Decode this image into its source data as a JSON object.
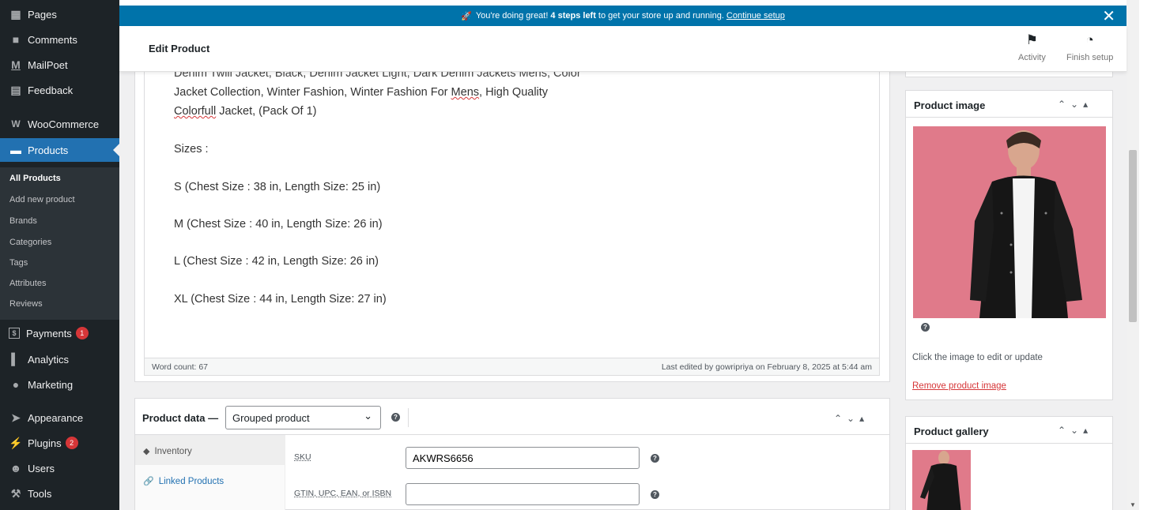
{
  "sidebar": {
    "items": [
      {
        "label": "Pages",
        "icon": "pages-icon"
      },
      {
        "label": "Comments",
        "icon": "comments-icon"
      },
      {
        "label": "MailPoet",
        "icon": "mailpoet-icon"
      },
      {
        "label": "Feedback",
        "icon": "feedback-icon"
      },
      {
        "label": "WooCommerce",
        "icon": "woocommerce-icon"
      },
      {
        "label": "Products",
        "icon": "products-icon"
      },
      {
        "label": "Payments",
        "icon": "payments-icon",
        "badge": "1"
      },
      {
        "label": "Analytics",
        "icon": "analytics-icon"
      },
      {
        "label": "Marketing",
        "icon": "marketing-icon"
      },
      {
        "label": "Appearance",
        "icon": "appearance-icon"
      },
      {
        "label": "Plugins",
        "icon": "plugins-icon",
        "badge": "2"
      },
      {
        "label": "Users",
        "icon": "users-icon"
      },
      {
        "label": "Tools",
        "icon": "tools-icon"
      }
    ],
    "submenu": [
      "All Products",
      "Add new product",
      "Brands",
      "Categories",
      "Tags",
      "Attributes",
      "Reviews"
    ]
  },
  "banner": {
    "text_before": "You're doing great!",
    "text_bold": "4 steps left",
    "text_after": "to get your store up and running.",
    "link": "Continue setup"
  },
  "header": {
    "title": "Edit Product",
    "activity": "Activity",
    "finish_setup": "Finish setup"
  },
  "editor": {
    "cut_line": "Denim Twill Jacket, Black, Denim Jacket Light, Dark Denim Jackets Mens, Color",
    "line2_a": "Jacket Collection, Winter Fashion, Winter Fashion For ",
    "line2_b": "Mens",
    "line2_c": ", High Quality",
    "line3_a": "Colorfull",
    "line3_b": " Jacket, (Pack Of 1)",
    "sizes": "Sizes :",
    "s": "S (Chest Size : 38 in, Length Size: 25 in)",
    "m": "M (Chest Size : 40 in, Length Size: 26 in)",
    "l": "L (Chest Size : 42 in, Length Size: 26 in)",
    "xl": "XL (Chest Size : 44 in, Length Size: 27 in)",
    "word_count": "Word count: 67",
    "last_edited": "Last edited by gowripriya on February 8, 2025 at 5:44 am"
  },
  "product_data": {
    "label": "Product data —",
    "type": "Grouped product",
    "tabs": [
      "Inventory",
      "Linked Products"
    ],
    "sku_label": "SKU",
    "sku_value": "AKWRS6656",
    "gtin_label": "GTIN, UPC, EAN, or ISBN",
    "gtin_value": ""
  },
  "product_image": {
    "title": "Product image",
    "hint": "Click the image to edit or update",
    "remove": "Remove product image"
  },
  "product_gallery": {
    "title": "Product gallery"
  },
  "colors": {
    "accent": "#2271b1",
    "sidebar": "#1d2327",
    "banner": "#0073aa",
    "badge": "#d63638",
    "image_bg": "#e07a8a"
  }
}
